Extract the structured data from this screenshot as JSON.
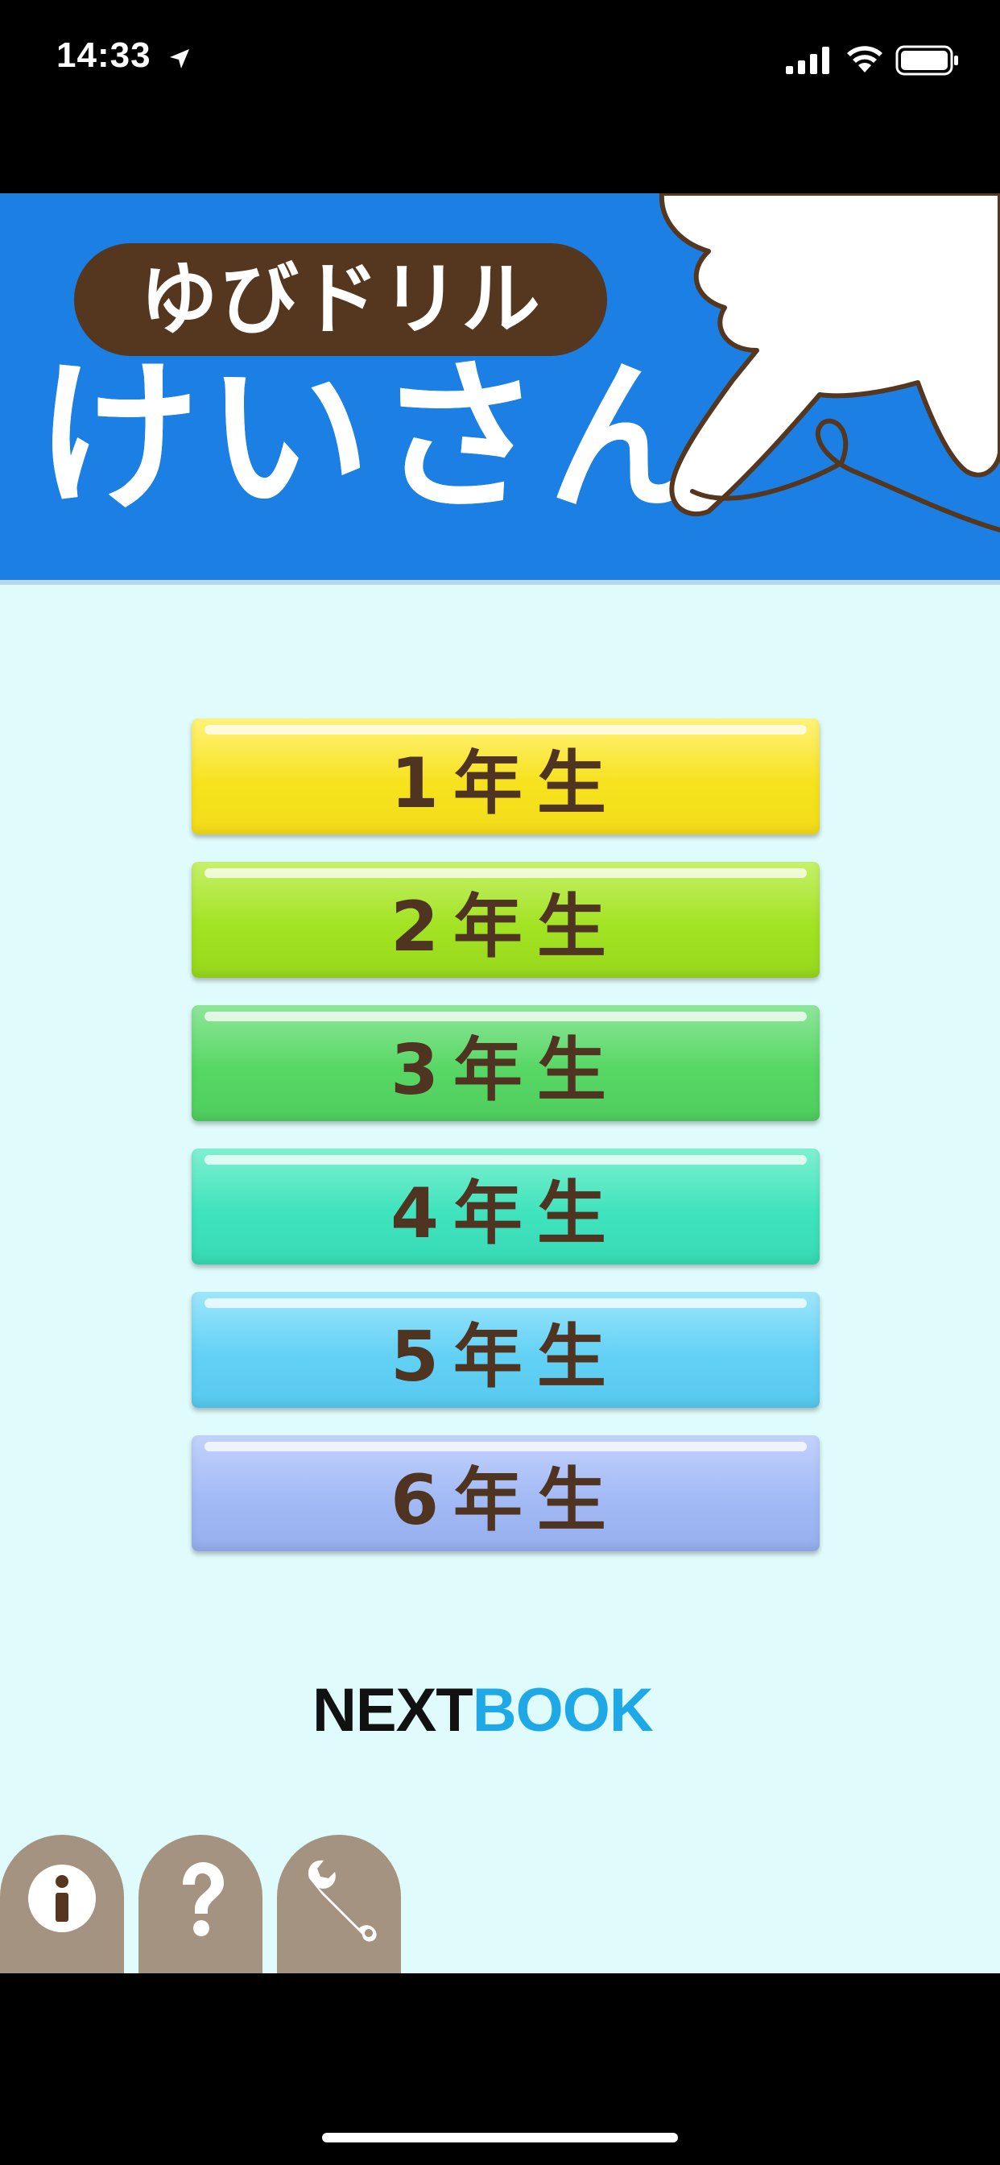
{
  "status_bar": {
    "time": "14:33",
    "icons": [
      "location-arrow-icon",
      "cellular-signal-icon",
      "wifi-icon",
      "battery-icon"
    ]
  },
  "header": {
    "app_series": "ゆびドリル",
    "title": "けいさん",
    "colors": {
      "band": "#1b7fe3",
      "pill": "#55361e"
    }
  },
  "grades": [
    {
      "label": "1年生",
      "color": "#f7e21e"
    },
    {
      "label": "2年生",
      "color": "#a2e322"
    },
    {
      "label": "3年生",
      "color": "#57d764"
    },
    {
      "label": "4年生",
      "color": "#3fe3bd"
    },
    {
      "label": "5年生",
      "color": "#62d1f5"
    },
    {
      "label": "6年生",
      "color": "#a2baf5"
    }
  ],
  "logo": {
    "part1": "NEXT",
    "part2": "BOOK"
  },
  "bottom_tabs": [
    {
      "icon": "info-icon"
    },
    {
      "icon": "question-icon"
    },
    {
      "icon": "wrench-icon"
    }
  ]
}
